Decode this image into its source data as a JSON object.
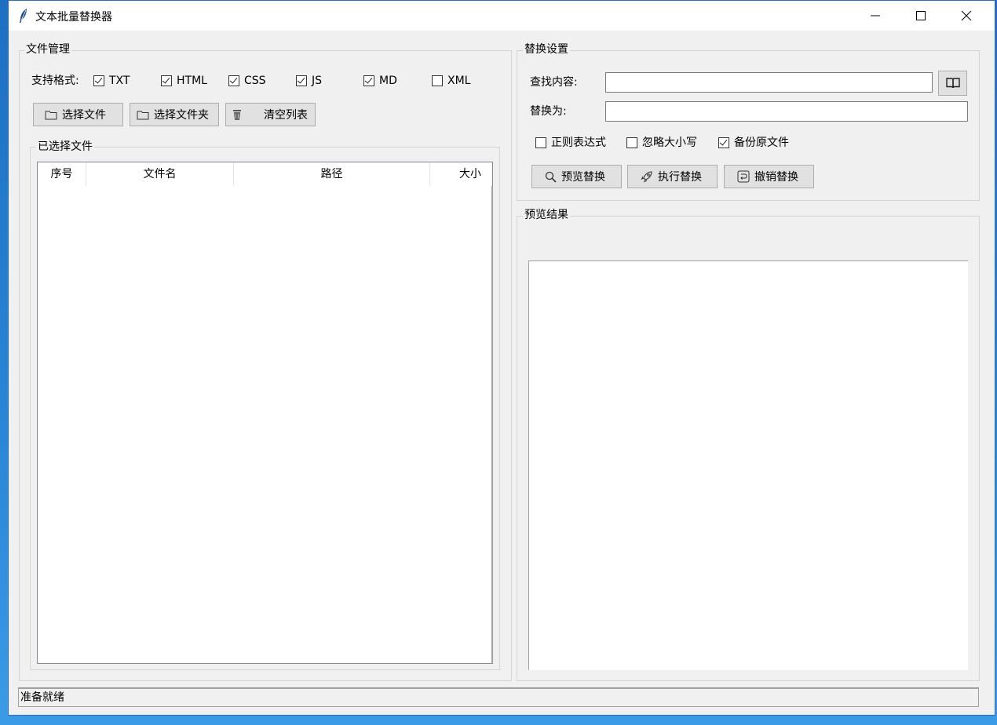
{
  "window": {
    "title": "文本批量替换器",
    "controls": {
      "minimize": "minimize-icon",
      "maximize": "maximize-icon",
      "close": "close-icon"
    }
  },
  "file_manager": {
    "title": "文件管理",
    "formats_label": "支持格式:",
    "formats": [
      {
        "label": "TXT",
        "checked": true
      },
      {
        "label": "HTML",
        "checked": true
      },
      {
        "label": "CSS",
        "checked": true
      },
      {
        "label": "JS",
        "checked": true
      },
      {
        "label": "MD",
        "checked": true
      },
      {
        "label": "XML",
        "checked": false
      }
    ],
    "buttons": {
      "select_files": "选择文件",
      "select_folder": "选择文件夹",
      "clear_list": "清空列表"
    },
    "selected_files": {
      "title": "已选择文件",
      "columns": [
        "序号",
        "文件名",
        "路径",
        "大小"
      ],
      "rows": []
    }
  },
  "replace_settings": {
    "title": "替换设置",
    "find_label": "查找内容:",
    "find_value": "",
    "replace_label": "替换为:",
    "replace_value": "",
    "options": [
      {
        "label": "正则表达式",
        "checked": false
      },
      {
        "label": "忽略大小写",
        "checked": false
      },
      {
        "label": "备份原文件",
        "checked": true
      }
    ],
    "buttons": {
      "preview": "预览替换",
      "execute": "执行替换",
      "undo": "撤销替换"
    },
    "icons": {
      "regex_help": "book-icon"
    }
  },
  "preview": {
    "title": "预览结果",
    "content": ""
  },
  "status": "准备就绪"
}
